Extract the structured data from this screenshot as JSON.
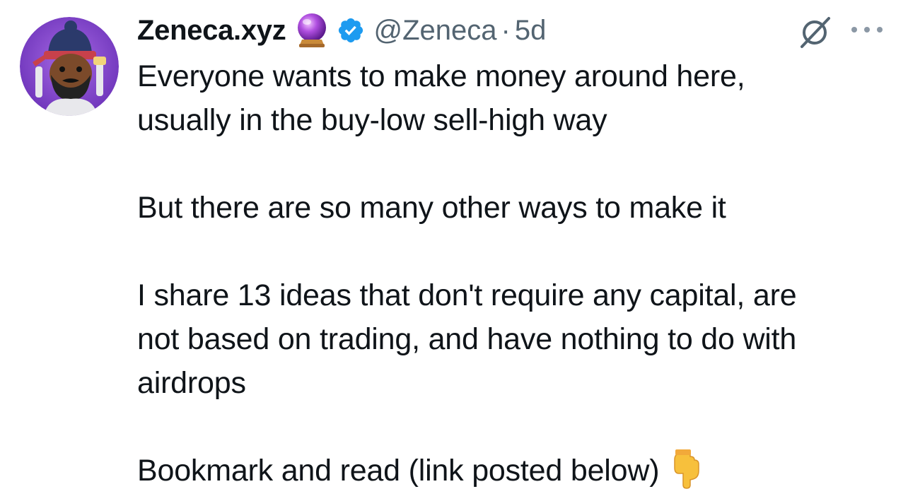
{
  "tweet": {
    "display_name": "Zeneca.xyz",
    "name_emoji": "crystal-ball-emoji",
    "verified": "verified-badge-icon",
    "handle": "@Zeneca",
    "separator": "·",
    "timestamp": "5d",
    "lines": [
      "Everyone wants to make money around here,",
      "usually in the buy-low sell-high way",
      "But there are so many other ways to make it",
      "I share 13 ideas that don't require any capital, are",
      "not based on trading, and have nothing to do with",
      "airdrops",
      "Bookmark and read (link posted below)"
    ],
    "last_line_emoji": "backhand-index-pointing-down-emoji"
  },
  "colors": {
    "text": "#0f1419",
    "secondary": "#536471",
    "verified_blue": "#1d9bf0",
    "avatar_bg": "#8a4fd6"
  }
}
